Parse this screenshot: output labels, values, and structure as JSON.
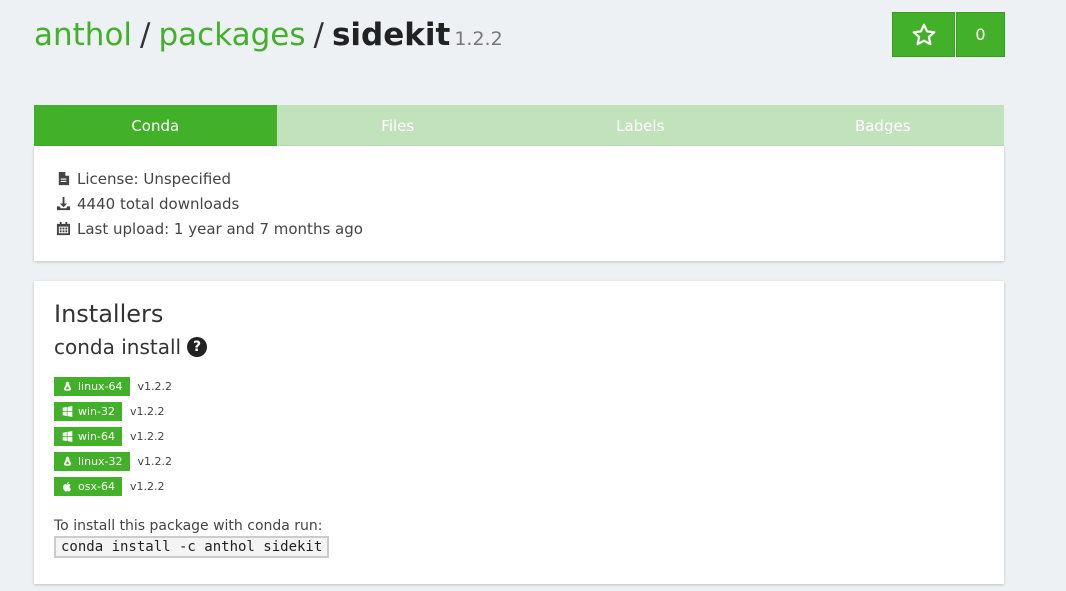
{
  "header": {
    "owner": "anthol",
    "section": "packages",
    "package": "sidekit",
    "version": "1.2.2",
    "separator": "/"
  },
  "star": {
    "count": "0",
    "icon": "star-outline-icon"
  },
  "tabs": [
    {
      "label": "Conda",
      "active": true
    },
    {
      "label": "Files",
      "active": false
    },
    {
      "label": "Labels",
      "active": false
    },
    {
      "label": "Badges",
      "active": false
    }
  ],
  "info": {
    "license": "License: Unspecified",
    "downloads": "4440 total downloads",
    "last_upload": "Last upload: 1 year and 7 months ago"
  },
  "installers": {
    "title": "Installers",
    "conda_title": "conda install",
    "help_glyph": "?",
    "platforms": [
      {
        "name": "linux-64",
        "version": "v1.2.2",
        "icon": "linux-icon"
      },
      {
        "name": "win-32",
        "version": "v1.2.2",
        "icon": "windows-icon"
      },
      {
        "name": "win-64",
        "version": "v1.2.2",
        "icon": "windows-icon"
      },
      {
        "name": "linux-32",
        "version": "v1.2.2",
        "icon": "linux-icon"
      },
      {
        "name": "osx-64",
        "version": "v1.2.2",
        "icon": "apple-icon"
      }
    ],
    "run_label": "To install this package with conda run:",
    "command": "conda install -c anthol sidekit"
  },
  "colors": {
    "accent": "#43b02a",
    "tab_inactive": "#c1e2bb",
    "background": "#eef1f4"
  }
}
